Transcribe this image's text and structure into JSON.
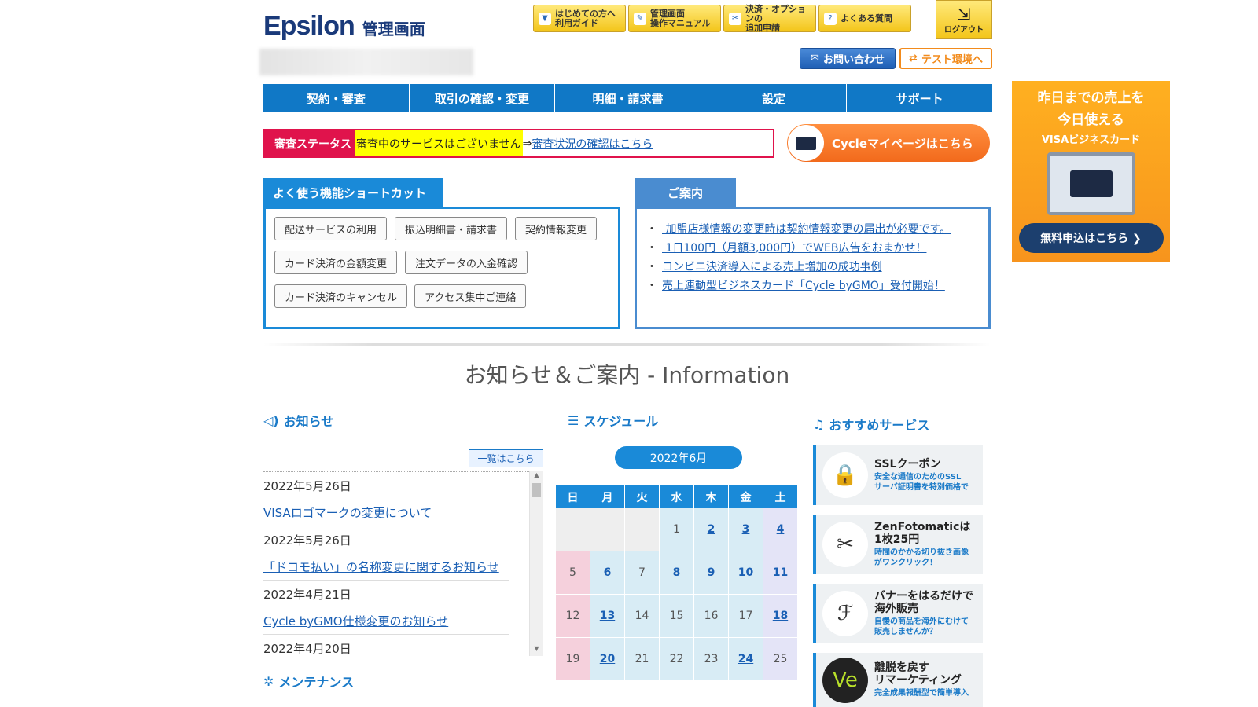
{
  "header": {
    "brand": "Epsilon",
    "subtitle": "管理画面",
    "top_links": [
      {
        "icon": "beginner-icon",
        "label": "はじめての方へ\n利用ガイド"
      },
      {
        "icon": "manual-icon",
        "label": "管理画面\n操作マニュアル"
      },
      {
        "icon": "tools-icon",
        "label": "決済・オプションの\n追加申請"
      },
      {
        "icon": "faq-icon",
        "label": "よくある質問"
      }
    ],
    "logout_label": "ログアウト",
    "contact_label": "お問い合わせ",
    "test_env_label": "テスト環境へ"
  },
  "nav": [
    "契約・審査",
    "取引の確認・変更",
    "明細・請求書",
    "設定",
    "サポート"
  ],
  "status": {
    "tag": "審査ステータス",
    "message": "審査中のサービスはございません",
    "arrow": "⇒",
    "link": "審査状況の確認はこちら"
  },
  "cycle_button": "Cycleマイページはこちら",
  "shortcuts": {
    "title": "よく使う機能ショートカット",
    "rows": [
      [
        "配送サービスの利用",
        "振込明細書・請求書",
        "契約情報変更"
      ],
      [
        "カード決済の金額変更",
        "注文データの入金確認"
      ],
      [
        "カード決済のキャンセル",
        "アクセス集中ご連絡"
      ]
    ]
  },
  "guide": {
    "title": "ご案内",
    "items": [
      " 加盟店様情報の変更時は契約情報変更の届出が必要です。",
      " 1日100円（月額3,000円）でWEB広告をおまかせ！",
      "コンビニ決済導入による売上増加の成功事例",
      "売上連動型ビジネスカード「Cycle byGMO」受付開始！"
    ]
  },
  "info_title": "お知らせ＆ご案内 - Information",
  "news": {
    "title": "お知らせ",
    "list_link": "一覧はこちら",
    "items": [
      {
        "date": "2022年5月26日",
        "title": "VISAロゴマークの変更について"
      },
      {
        "date": "2022年5月26日",
        "title": "「ドコモ払い」の名称変更に関するお知らせ"
      },
      {
        "date": "2022年4月21日",
        "title": "Cycle byGMO仕様変更のお知らせ"
      },
      {
        "date": "2022年4月20日",
        "title": ""
      }
    ]
  },
  "maintenance_title": "メンテナンス",
  "schedule": {
    "title": "スケジュール",
    "month": "2022年6月",
    "weekdays": [
      "日",
      "月",
      "火",
      "水",
      "木",
      "金",
      "土"
    ],
    "weeks": [
      [
        "",
        "",
        "",
        "1",
        "2",
        "3",
        "4"
      ],
      [
        "5",
        "6",
        "7",
        "8",
        "9",
        "10",
        "11"
      ],
      [
        "12",
        "13",
        "14",
        "15",
        "16",
        "17",
        "18"
      ],
      [
        "19",
        "20",
        "21",
        "22",
        "23",
        "24",
        "25"
      ]
    ],
    "linked_days": [
      "2",
      "3",
      "4",
      "6",
      "8",
      "9",
      "10",
      "11",
      "13",
      "18",
      "20",
      "24"
    ]
  },
  "recommend": {
    "title": "おすすめサービス",
    "items": [
      {
        "icon": "lock-icon",
        "title": "SSLクーポン",
        "desc": "安全な通信のためのSSL\nサーバ証明書を特別価格で"
      },
      {
        "icon": "scissors-icon",
        "title": "ZenFotomaticは\n1枚25円",
        "desc": "時間のかかる切り抜き画像\nがワンクリック！"
      },
      {
        "icon": "brand-icon",
        "title": "バナーをはるだけで\n海外販売",
        "desc": "自慢の商品を海外にむけて\n販売しませんか？"
      },
      {
        "icon": "retarget-icon",
        "title": "離脱を戻す\nリマーケティング",
        "desc": "完全成果報酬型で簡単導入"
      }
    ]
  },
  "ad": {
    "line1": "昨日までの売上を",
    "line2": "今日使える",
    "line3": "VISAビジネスカード",
    "cta": "無料申込はこちら ❯"
  },
  "colors": {
    "nav": "#1078c6",
    "accent": "#1a8ad8",
    "alert": "#e0134c",
    "orange": "#f26a1c"
  }
}
